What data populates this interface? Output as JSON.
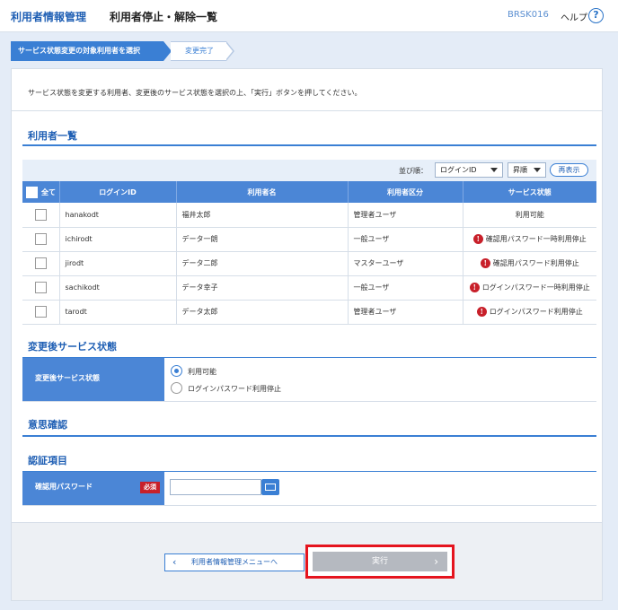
{
  "header": {
    "app_title": "利用者情報管理",
    "page_title": "利用者停止・解除一覧",
    "screen_code": "BRSK016",
    "help_label": "ヘルプ",
    "help_icon": "?"
  },
  "steps": [
    {
      "label": "サービス状態変更の対象利用者を選択"
    },
    {
      "label": "変更完了"
    }
  ],
  "instruction": "サービス状態を変更する利用者、変更後のサービス状態を選択の上、「実行」ボタンを押してください。",
  "user_list": {
    "section_title": "利用者一覧",
    "sort_label": "並び順：",
    "sort_field": "ログインID",
    "sort_order": "昇順",
    "redisplay_label": "再表示",
    "columns": {
      "all": "全て",
      "login_id": "ログインID",
      "user_name": "利用者名",
      "user_type": "利用者区分",
      "service_status": "サービス状態"
    },
    "rows": [
      {
        "login_id": "hanakodt",
        "user_name": "福井太郎",
        "user_type": "管理者ユーザ",
        "service_status": "利用可能",
        "warning": false
      },
      {
        "login_id": "ichirodt",
        "user_name": "データ一朗",
        "user_type": "一般ユーザ",
        "service_status": "確認用パスワード一時利用停止",
        "warning": true
      },
      {
        "login_id": "jirodt",
        "user_name": "データ二郎",
        "user_type": "マスターユーザ",
        "service_status": "確認用パスワード利用停止",
        "warning": true
      },
      {
        "login_id": "sachikodt",
        "user_name": "データ幸子",
        "user_type": "一般ユーザ",
        "service_status": "ログインパスワード一時利用停止",
        "warning": true
      },
      {
        "login_id": "tarodt",
        "user_name": "データ太郎",
        "user_type": "管理者ユーザ",
        "service_status": "ログインパスワード利用停止",
        "warning": true
      }
    ]
  },
  "after_status": {
    "section_title": "変更後サービス状態",
    "field_label": "変更後サービス状態",
    "options": [
      "利用可能",
      "ログインパスワード利用停止"
    ],
    "selected_index": 0
  },
  "confirm": {
    "section_title": "意思確認"
  },
  "auth": {
    "section_title": "認証項目",
    "field_label": "確認用パスワード",
    "required_badge": "必須",
    "password_value": ""
  },
  "footer": {
    "back_label": "利用者情報管理メニューへ",
    "execute_label": "実行"
  },
  "colors": {
    "accent": "#3a7fd4",
    "header_text": "#1f5fb4",
    "warning": "#c8202a",
    "highlight_frame": "#e5141e",
    "disabled_button": "#b5b9c0"
  }
}
